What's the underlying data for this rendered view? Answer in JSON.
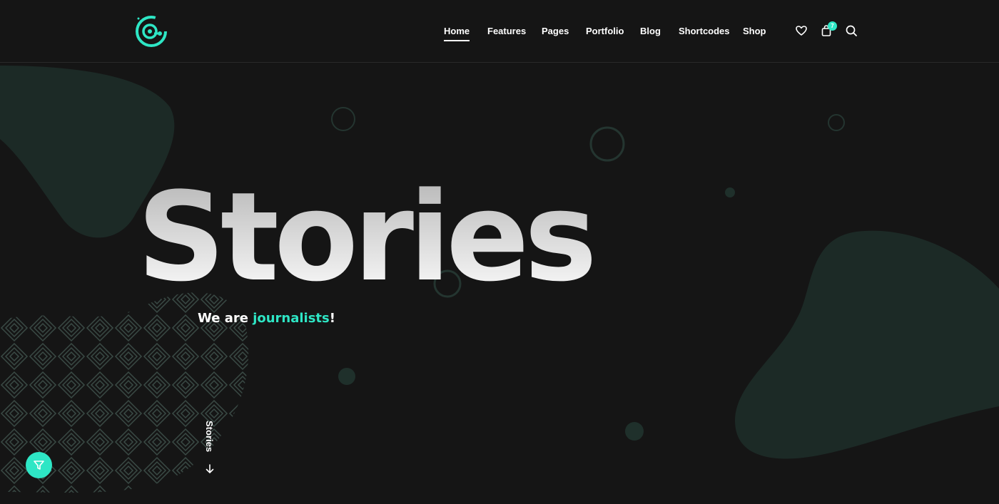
{
  "header": {
    "nav": [
      {
        "label": "Home",
        "active": true
      },
      {
        "label": "Features"
      },
      {
        "label": "Pages"
      },
      {
        "label": "Portfolio"
      },
      {
        "label": "Blog"
      },
      {
        "label": "Shortcodes"
      },
      {
        "label": "Shop"
      }
    ],
    "icons": [
      "heart-icon",
      "cart-icon",
      "search-icon"
    ],
    "cart_count": "7"
  },
  "hero": {
    "title": "Stories",
    "subtitle_prefix": "We are ",
    "subtitle_accent": "journalists",
    "subtitle_suffix": "!"
  },
  "scroll": {
    "label": "Stories"
  },
  "colors": {
    "accent": "#2ee6c5",
    "background": "#151515",
    "blob": "#1c2a26"
  }
}
